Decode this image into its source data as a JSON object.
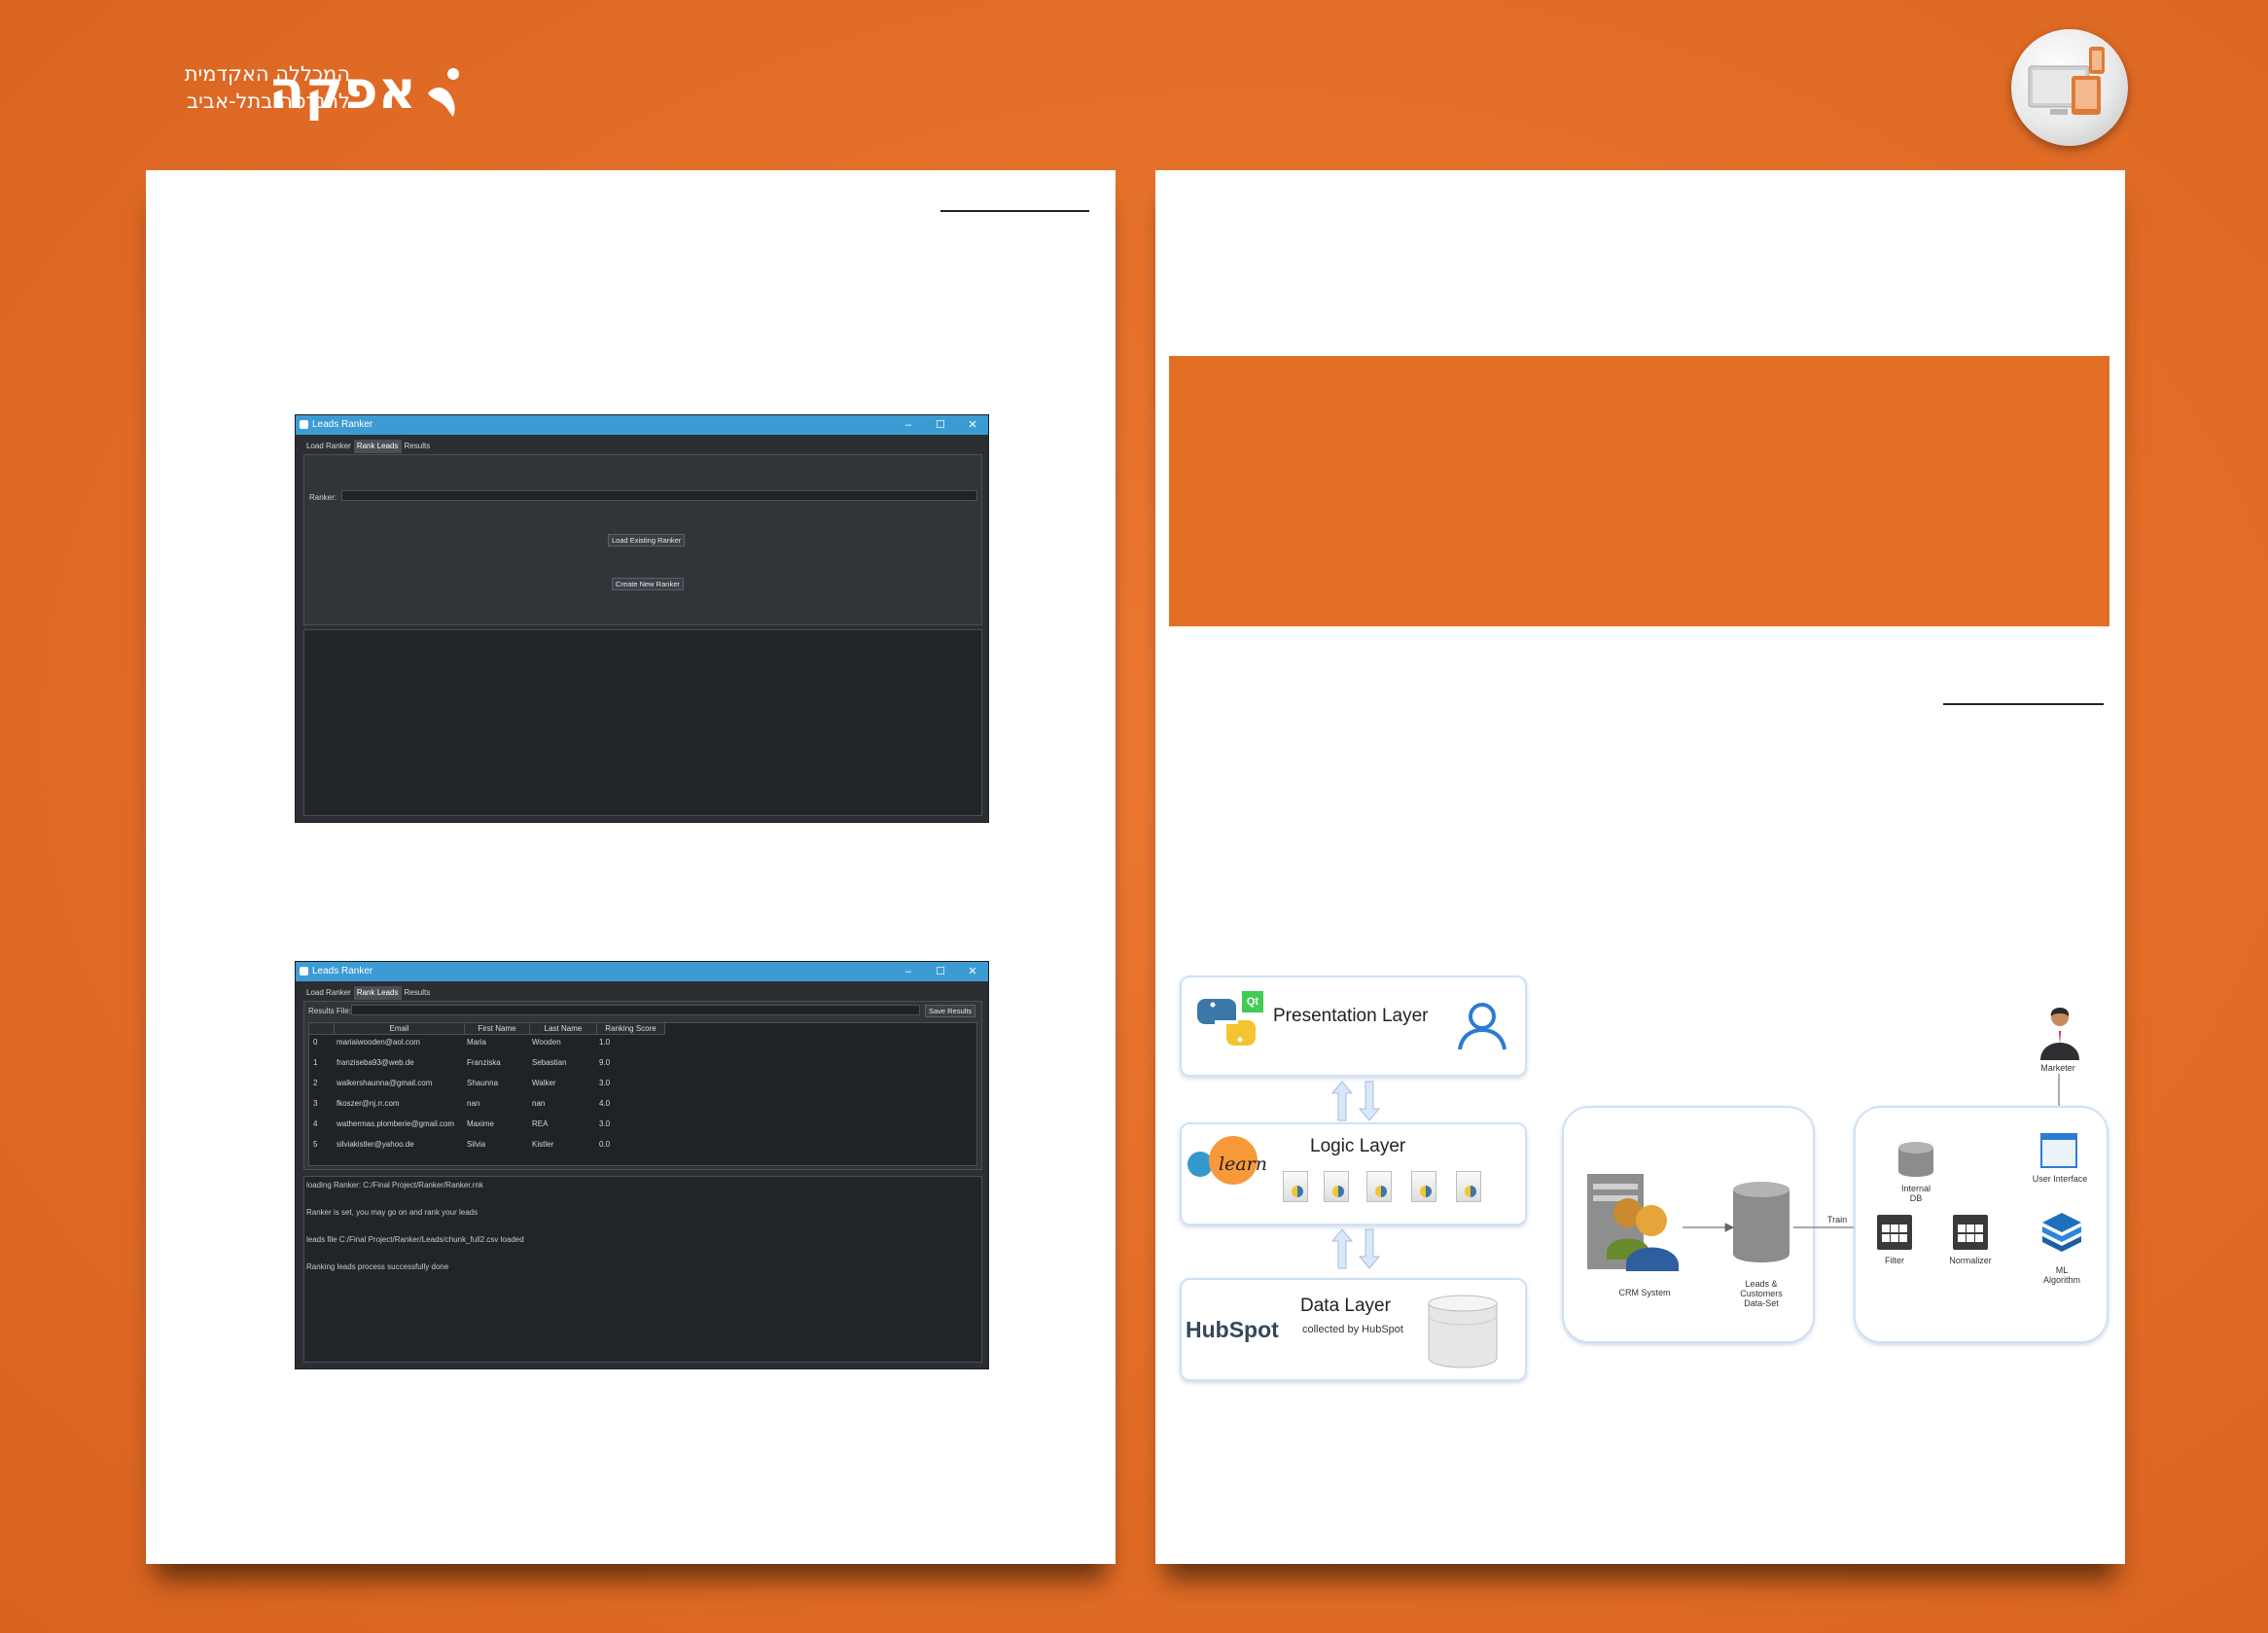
{
  "header": {
    "college_line1": "המכללה האקדמית",
    "college_line2": "להנדסה בתל-אביב",
    "college_brand": "אפקה"
  },
  "colors": {
    "background": "#e5702a",
    "banner": "#e36f25",
    "titlebar": "#3d9bd4",
    "app_background": "#2b2f33"
  },
  "window1": {
    "title": "Leads Ranker",
    "controls": [
      "–",
      "☐",
      "✕"
    ],
    "tabs": [
      "Load Ranker",
      "Rank Leads",
      "Results"
    ],
    "active_tab": "Rank Leads",
    "ranker_label": "Ranker:",
    "ranker_value": "",
    "load_button": "Load Existing Ranker",
    "create_button": "Create New Ranker"
  },
  "window2": {
    "title": "Leads Ranker",
    "controls": [
      "–",
      "☐",
      "✕"
    ],
    "tabs": [
      "Load Ranker",
      "Rank Leads",
      "Results"
    ],
    "active_tab": "Rank Leads",
    "results_label": "Results File:",
    "results_value": "",
    "save_button": "Save Results",
    "table": {
      "columns": [
        "Email",
        "First Name",
        "Last Name",
        "Ranking Score"
      ],
      "rows": [
        {
          "index": "0",
          "email": "mariaiwooden@aol.com",
          "first": "Maria",
          "last": "Wooden",
          "score": "1.0"
        },
        {
          "index": "1",
          "email": "franziseba93@web.de",
          "first": "Franziska",
          "last": "Sebastian",
          "score": "9.0"
        },
        {
          "index": "2",
          "email": "walkershaunna@gmail.com",
          "first": "Shaunna",
          "last": "Walker",
          "score": "3.0"
        },
        {
          "index": "3",
          "email": "fkoszer@nj.rr.com",
          "first": "nan",
          "last": "nan",
          "score": "4.0"
        },
        {
          "index": "4",
          "email": "wathermas.plomberie@gmail.com",
          "first": "Maxime",
          "last": "REA",
          "score": "3.0"
        },
        {
          "index": "5",
          "email": "silviakistler@yahoo.de",
          "first": "Silvia",
          "last": "Kistler",
          "score": "0.0"
        }
      ]
    },
    "log": [
      "loading Ranker: C:/Final Project/Ranker/Ranker.rnk",
      "Ranker is set, you may go on and rank your leads",
      "leads file C:/Final Project/Ranker/Leads/chunk_full2.csv loaded",
      "Ranking leads process successfully done"
    ]
  },
  "layers": {
    "presentation": {
      "title": "Presentation Layer",
      "logo_text": "Qt"
    },
    "logic": {
      "title": "Logic Layer",
      "logo_text": "learn"
    },
    "data": {
      "title": "Data Layer",
      "subtitle": "collected by HubSpot",
      "logo_text": "HubSpot"
    }
  },
  "architecture": {
    "crm_label": "CRM System",
    "dataset_label": [
      "Leads &",
      "Customers",
      "Data-Set"
    ],
    "train_label": "Train",
    "filter_label": "Filter",
    "internal_db_label": [
      "Internal",
      "DB"
    ],
    "normalizer_label": "Normalizer",
    "marketer_label": "Marketer",
    "ui_label": "User Interface",
    "ml_label": [
      "ML",
      "Algorithm"
    ]
  }
}
